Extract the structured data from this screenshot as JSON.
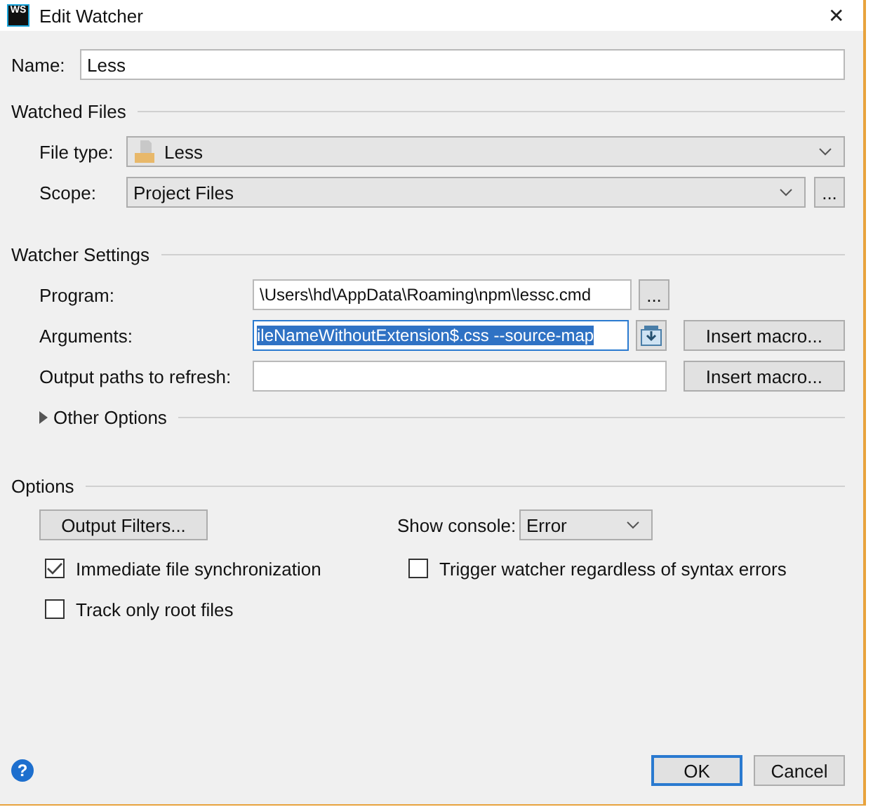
{
  "window": {
    "title": "Edit Watcher",
    "logo_text": "WS",
    "close_glyph": "✕"
  },
  "name": {
    "label": "Name:",
    "value": "Less"
  },
  "watched_files": {
    "title": "Watched Files",
    "file_type": {
      "label": "File type:",
      "value": "Less"
    },
    "scope": {
      "label": "Scope:",
      "value": "Project Files",
      "browse": "..."
    }
  },
  "watcher_settings": {
    "title": "Watcher Settings",
    "program": {
      "label": "Program:",
      "value": "\\Users\\hd\\AppData\\Roaming\\npm\\lessc.cmd",
      "browse": "..."
    },
    "arguments": {
      "label": "Arguments:",
      "value": "ileNameWithoutExtension$.css --source-map",
      "text_selected": true,
      "macro_button": "Insert macro..."
    },
    "output_paths": {
      "label": "Output paths to refresh:",
      "macro_button": "Insert macro..."
    },
    "other_options": {
      "label": "Other Options",
      "expanded": false
    }
  },
  "options": {
    "title": "Options",
    "output_filters": "Output Filters...",
    "show_console": {
      "label": "Show console:",
      "value": "Error"
    },
    "checkboxes": [
      {
        "label": "Immediate file synchronization",
        "checked": true
      },
      {
        "label": "Trigger watcher regardless of syntax errors",
        "checked": false
      },
      {
        "label": "Track only root files",
        "checked": false
      }
    ]
  },
  "footer": {
    "help": "?",
    "buttons": [
      {
        "label": "OK",
        "default": true
      },
      {
        "label": "Cancel",
        "default": false
      }
    ]
  }
}
